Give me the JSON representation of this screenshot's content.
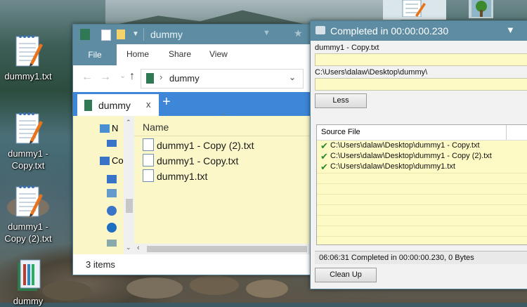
{
  "desktop": {
    "icons": [
      {
        "label_line1": "dummy1.txt",
        "label_line2": ""
      },
      {
        "label_line1": "dummy1 -",
        "label_line2": "Copy.txt"
      },
      {
        "label_line1": "dummy1 -",
        "label_line2": "Copy (2).txt"
      },
      {
        "label_line1": "dummy",
        "label_line2": ""
      }
    ]
  },
  "explorer": {
    "title": "dummy",
    "ribbon_tabs": [
      "File",
      "Home",
      "Share",
      "View"
    ],
    "address_folder": "dummy",
    "tab_label": "dummy",
    "tab_close": "x",
    "new_tab": "+",
    "nav_items": [
      "N",
      "Co"
    ],
    "column_header": "Name",
    "files": [
      "dummy1 - Copy (2).txt",
      "dummy1 - Copy.txt",
      "dummy1.txt"
    ],
    "status_text": "3 items"
  },
  "dialog": {
    "title": "Completed in 00:00:00.230",
    "name_label": "dummy1 - Copy.txt",
    "path_label": "C:\\Users\\dalaw\\Desktop\\dummy\\",
    "less_button": "Less",
    "list_header": "Source File",
    "rows": [
      "C:\\Users\\dalaw\\Desktop\\dummy1 - Copy.txt",
      "C:\\Users\\dalaw\\Desktop\\dummy1 - Copy (2).txt",
      "C:\\Users\\dalaw\\Desktop\\dummy1.txt"
    ],
    "status": "06:06:31 Completed in 00:00:00.230, 0 Bytes",
    "cleanup_button": "Clean Up"
  },
  "colors": {
    "titlebar": "#5e8da3",
    "tab_strip": "#3d86d8",
    "highlight_yellow": "#fbf7c8",
    "check_green": "#2a8a2a"
  }
}
